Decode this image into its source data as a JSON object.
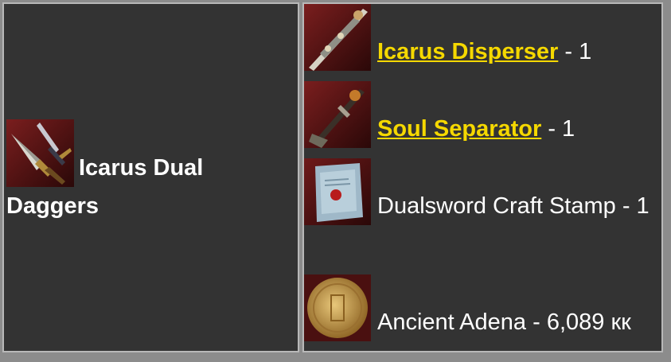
{
  "recipe": {
    "product": {
      "name": "Icarus Dual Daggers",
      "icon": "dual-daggers-icon"
    },
    "ingredients": [
      {
        "name": "Icarus Disperser",
        "linked": true,
        "quantity_text": " - 1",
        "icon": "icarus-disperser-icon"
      },
      {
        "name": "Soul Separator",
        "linked": true,
        "quantity_text": " - 1",
        "icon": "soul-separator-icon"
      },
      {
        "name": "Dualsword Craft Stamp",
        "linked": false,
        "quantity_text": " - 1",
        "icon": "craft-stamp-icon"
      },
      {
        "name": "Ancient Adena",
        "linked": false,
        "quantity_text": " - 6,089 кк",
        "icon": "ancient-adena-icon"
      }
    ]
  },
  "colors": {
    "cell_bg": "#333333",
    "border": "#b8b8b8",
    "link": "#f5d800",
    "text": "#ffffff"
  }
}
